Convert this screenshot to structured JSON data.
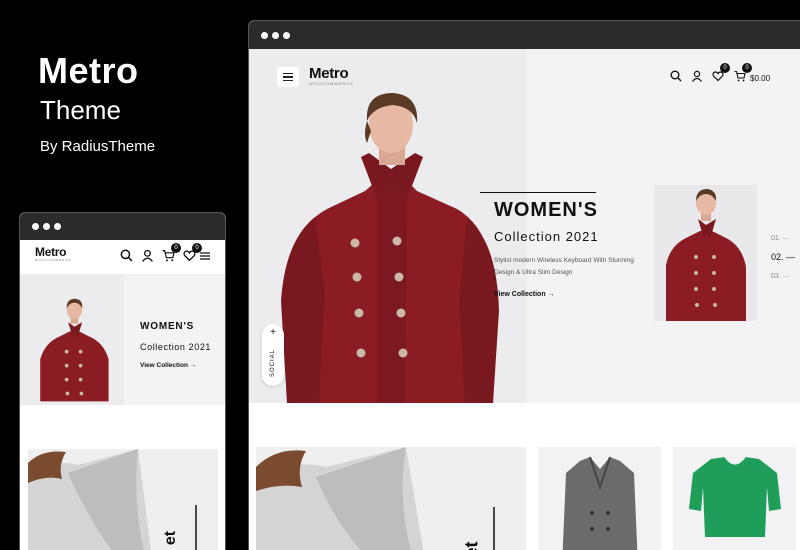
{
  "branding": {
    "title": "Metro",
    "subtitle": "Theme",
    "byline": "By RadiusTheme"
  },
  "desktop": {
    "logo": {
      "main": "Metro",
      "sub": "WOOCOMMERCE"
    },
    "header": {
      "wishlist_count": "0",
      "cart_count": "0",
      "cart_total": "$0.00"
    },
    "hero": {
      "title": "WOMEN'S",
      "subtitle": "Collection 2021",
      "description": "Stylist modern Wireless Keyboard With Stunning Design & Ultra Slim Design",
      "link_label": "View Collection",
      "slides": [
        "01.",
        "02.",
        "03."
      ],
      "active_slide": "02."
    },
    "social": {
      "plus": "+",
      "label": "SOCIAL"
    },
    "promo_text": "et"
  },
  "mobile": {
    "logo": {
      "main": "Metro",
      "sub": "WOOCOMMERCE"
    },
    "header": {
      "cart_count": "0",
      "wishlist_count": "0"
    },
    "hero": {
      "title": "WOMEN'S",
      "subtitle": "Collection 2021",
      "link_label": "View Collection"
    },
    "promo_text": "et"
  },
  "colors": {
    "coat": "#8b1c24",
    "coat_shadow": "#6e141b",
    "green_sweater": "#1f9e59",
    "grey_coat": "#6b6b6b"
  }
}
